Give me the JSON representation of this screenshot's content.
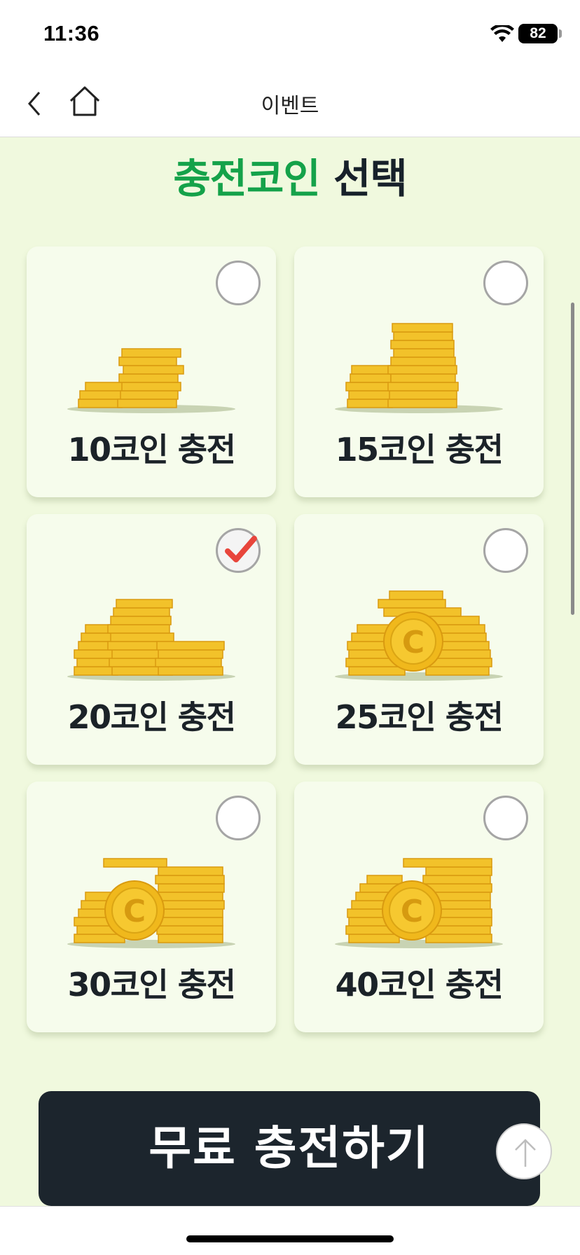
{
  "status": {
    "time": "11:36",
    "battery": "82"
  },
  "nav": {
    "title": "이벤트"
  },
  "heading": {
    "highlight": "충전코인",
    "rest": " 선택"
  },
  "options": [
    {
      "label": "10코인 충전",
      "selected": false
    },
    {
      "label": "15코인 충전",
      "selected": false
    },
    {
      "label": "20코인 충전",
      "selected": true
    },
    {
      "label": "25코인 충전",
      "selected": false
    },
    {
      "label": "30코인 충전",
      "selected": false
    },
    {
      "label": "40코인 충전",
      "selected": false
    }
  ],
  "cta": {
    "label": "무료 충전하기"
  },
  "icons": {
    "wifi": "wifi-icon",
    "back": "chevron-left-icon",
    "home": "home-icon",
    "check": "checkmark-icon",
    "scroll_top": "arrow-up-icon"
  },
  "colors": {
    "background": "#f0f9de",
    "accent": "#15a24a",
    "button": "#1c252d",
    "check": "#e8453c"
  }
}
